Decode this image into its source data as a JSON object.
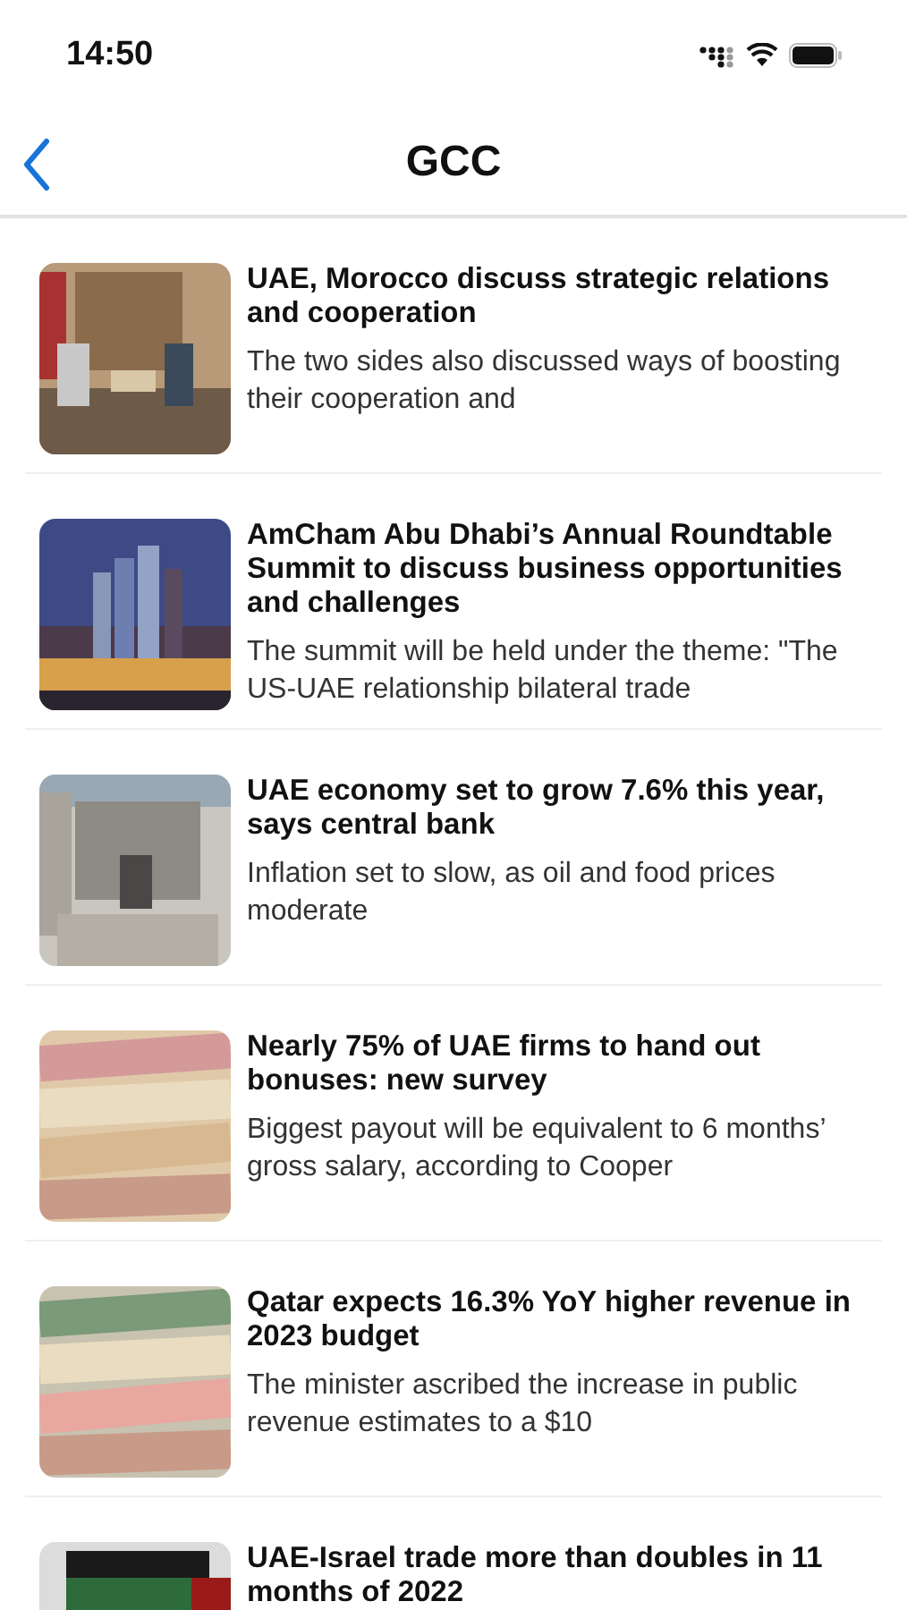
{
  "status_bar": {
    "time": "14:50"
  },
  "nav": {
    "title": "GCC"
  },
  "articles": [
    {
      "title": "UAE, Morocco discuss strategic relations and cooperation",
      "summary": "The two sides also discussed ways of boosting their cooperation and"
    },
    {
      "title": "AmCham Abu Dhabi’s Annual Roundtable Summit to discuss business opportunities and challenges",
      "summary": "The summit will be held under the theme: \"The US-UAE relationship bilateral trade"
    },
    {
      "title": "UAE economy set to grow 7.6% this year, says central bank",
      "summary": "Inflation set to slow, as oil and food prices moderate"
    },
    {
      "title": "Nearly 75% of UAE firms to hand out bonuses: new survey",
      "summary": "Biggest payout will be equivalent to 6 months’ gross salary, according to Cooper"
    },
    {
      "title": "Qatar expects 16.3% YoY higher revenue in 2023 budget",
      "summary": "The minister ascribed the increase in public revenue estimates to a $10"
    },
    {
      "title": "UAE-Israel trade more than doubles in 11 months of 2022"
    }
  ]
}
